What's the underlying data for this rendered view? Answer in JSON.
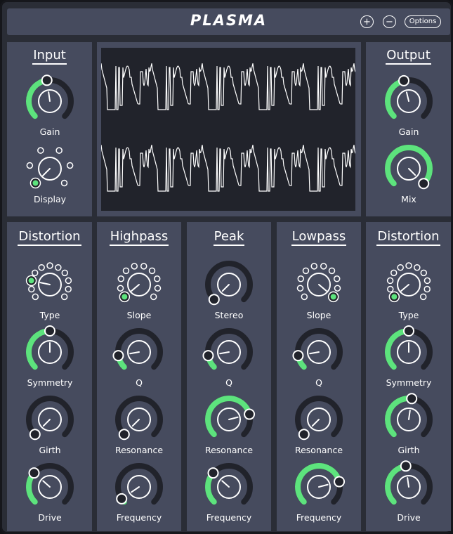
{
  "header": {
    "title": "PLASMA",
    "plus_label": "+",
    "minus_label": "−",
    "options_label": "Options"
  },
  "colors": {
    "accent": "#5de37d",
    "panel": "#464b5e",
    "background": "#2a2d36",
    "track": "#21232b",
    "scope_bg": "#21232b"
  },
  "panels": {
    "input": {
      "title": "Input",
      "gain": {
        "label": "Gain",
        "value": 0.47
      },
      "display": {
        "label": "Display",
        "options": 6,
        "selected": 0
      }
    },
    "output": {
      "title": "Output",
      "gain": {
        "label": "Gain",
        "value": 0.45
      },
      "mix": {
        "label": "Mix",
        "value": 1.0
      }
    },
    "distortion1": {
      "title": "Distortion",
      "type": {
        "label": "Type",
        "options": 11,
        "selected": 2
      },
      "symmetry": {
        "label": "Symmetry",
        "value": 0.5
      },
      "girth": {
        "label": "Girth",
        "value": 0.0
      },
      "drive": {
        "label": "Drive",
        "value": 0.32
      }
    },
    "highpass": {
      "title": "Highpass",
      "slope": {
        "label": "Slope",
        "options": 10,
        "selected": 0
      },
      "q": {
        "label": "Q",
        "value": 0.13
      },
      "resonance": {
        "label": "Resonance",
        "value": 0.0
      },
      "frequency": {
        "label": "Frequency",
        "value": 0.04
      }
    },
    "peak": {
      "title": "Peak",
      "stereo": {
        "label": "Stereo",
        "value": 0.0
      },
      "q": {
        "label": "Q",
        "value": 0.13
      },
      "resonance": {
        "label": "Resonance",
        "value": 0.78
      },
      "frequency": {
        "label": "Frequency",
        "value": 0.32
      }
    },
    "lowpass": {
      "title": "Lowpass",
      "slope": {
        "label": "Slope",
        "options": 10,
        "selected": 9
      },
      "q": {
        "label": "Q",
        "value": 0.13
      },
      "resonance": {
        "label": "Resonance",
        "value": 0.0
      },
      "frequency": {
        "label": "Frequency",
        "value": 0.78
      }
    },
    "distortion2": {
      "title": "Distortion",
      "type": {
        "label": "Type",
        "options": 11,
        "selected": 0
      },
      "symmetry": {
        "label": "Symmetry",
        "value": 0.5
      },
      "girth": {
        "label": "Girth",
        "value": 0.53
      },
      "drive": {
        "label": "Drive",
        "value": 0.47
      }
    }
  }
}
